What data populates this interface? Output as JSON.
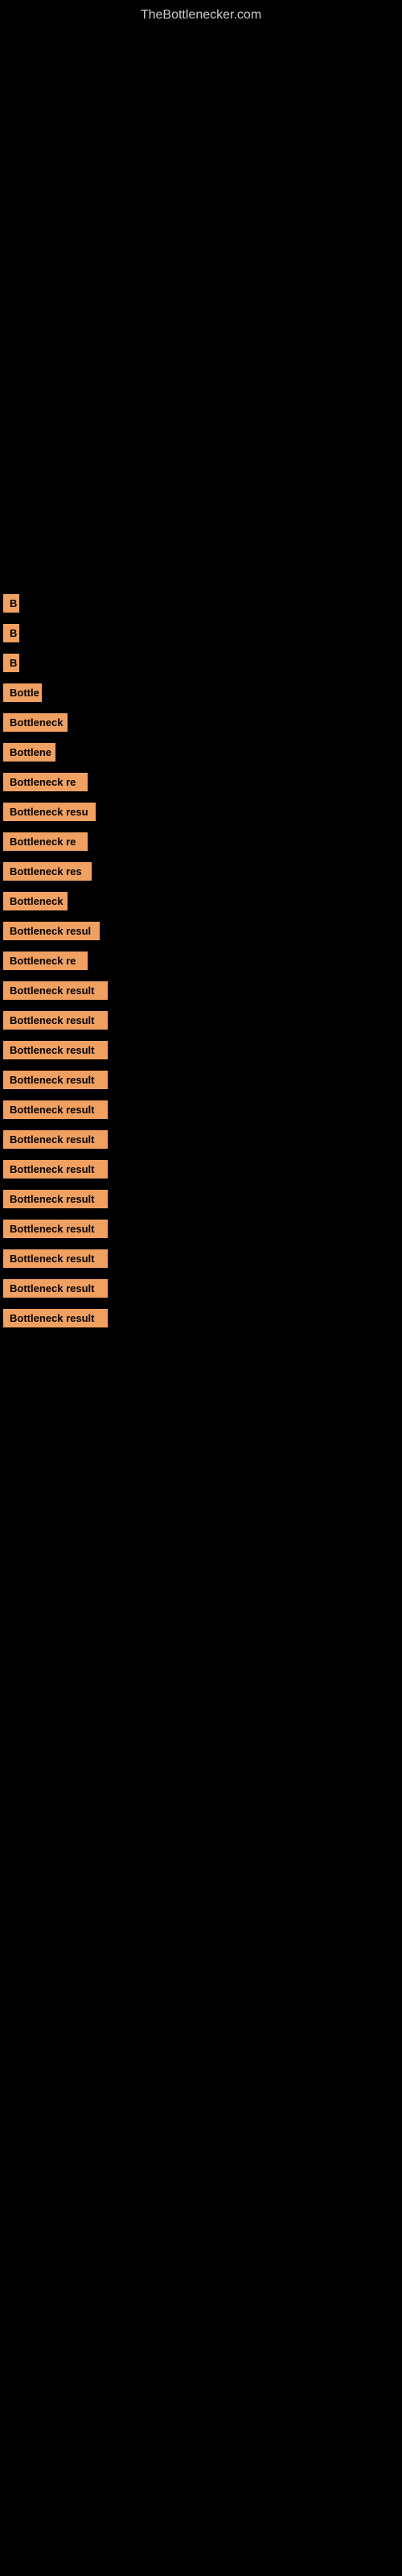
{
  "site": {
    "title": "TheBottlenecker.com"
  },
  "bars": [
    {
      "label": "B",
      "width": 18
    },
    {
      "label": "B",
      "width": 18
    },
    {
      "label": "B",
      "width": 18
    },
    {
      "label": "Bottle",
      "width": 48
    },
    {
      "label": "Bottleneck",
      "width": 80
    },
    {
      "label": "Bottlene",
      "width": 65
    },
    {
      "label": "Bottleneck re",
      "width": 105
    },
    {
      "label": "Bottleneck resu",
      "width": 115
    },
    {
      "label": "Bottleneck re",
      "width": 105
    },
    {
      "label": "Bottleneck res",
      "width": 110
    },
    {
      "label": "Bottleneck",
      "width": 80
    },
    {
      "label": "Bottleneck resul",
      "width": 120
    },
    {
      "label": "Bottleneck re",
      "width": 105
    },
    {
      "label": "Bottleneck result",
      "width": 130
    },
    {
      "label": "Bottleneck result",
      "width": 130
    },
    {
      "label": "Bottleneck result",
      "width": 130
    },
    {
      "label": "Bottleneck result",
      "width": 130
    },
    {
      "label": "Bottleneck result",
      "width": 130
    },
    {
      "label": "Bottleneck result",
      "width": 130
    },
    {
      "label": "Bottleneck result",
      "width": 130
    },
    {
      "label": "Bottleneck result",
      "width": 130
    },
    {
      "label": "Bottleneck result",
      "width": 130
    },
    {
      "label": "Bottleneck result",
      "width": 130
    },
    {
      "label": "Bottleneck result",
      "width": 130
    },
    {
      "label": "Bottleneck result",
      "width": 130
    }
  ]
}
